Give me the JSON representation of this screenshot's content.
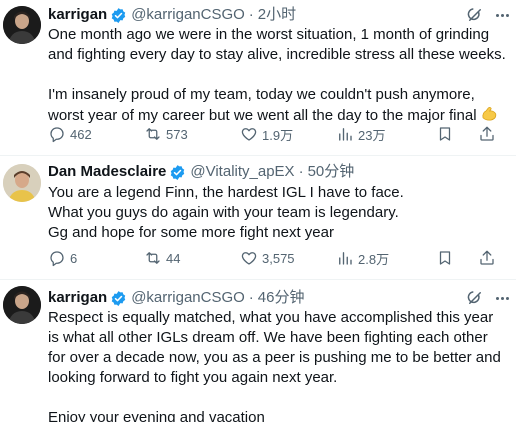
{
  "tweets": [
    {
      "name": "karrigan",
      "handle": "@karriganCSGO",
      "time": "2小时",
      "body": [
        "One month ago we were in the worst situation, 1 month of grinding and fighting every day to stay alive, incredible stress all these weeks.",
        "I'm insanely proud of my team, today we couldn't push anymore, worst year of my career but we went all the day to the major final"
      ],
      "emoji": "flexed-biceps-icon",
      "stats": {
        "replies": "462",
        "reposts": "573",
        "likes": "1.9万",
        "views": "23万"
      }
    },
    {
      "name": "Dan Madesclaire",
      "handle": "@Vitality_apEX",
      "time": "50分钟",
      "body": [
        "You are a legend Finn, the hardest IGL I have to face.",
        "What you guys do again with your team is legendary.",
        "Gg and hope for some more fight next year"
      ],
      "stats": {
        "replies": "6",
        "reposts": "44",
        "likes": "3,575",
        "views": "2.8万"
      }
    },
    {
      "name": "karrigan",
      "handle": "@karriganCSGO",
      "time": "46分钟",
      "body": [
        "Respect is equally matched, what you have accomplished this year is what all other IGLs dream off. We have been fighting each other for over a decade now, you as a peer is pushing me to be better and looking forward to fight you again next year.",
        "Enjoy your evening and vacation"
      ]
    }
  ],
  "dot": "·",
  "colors": {
    "verified": "#1d9bf0",
    "text": "#0f1419",
    "muted": "#536471",
    "divider": "#eff3f4"
  }
}
